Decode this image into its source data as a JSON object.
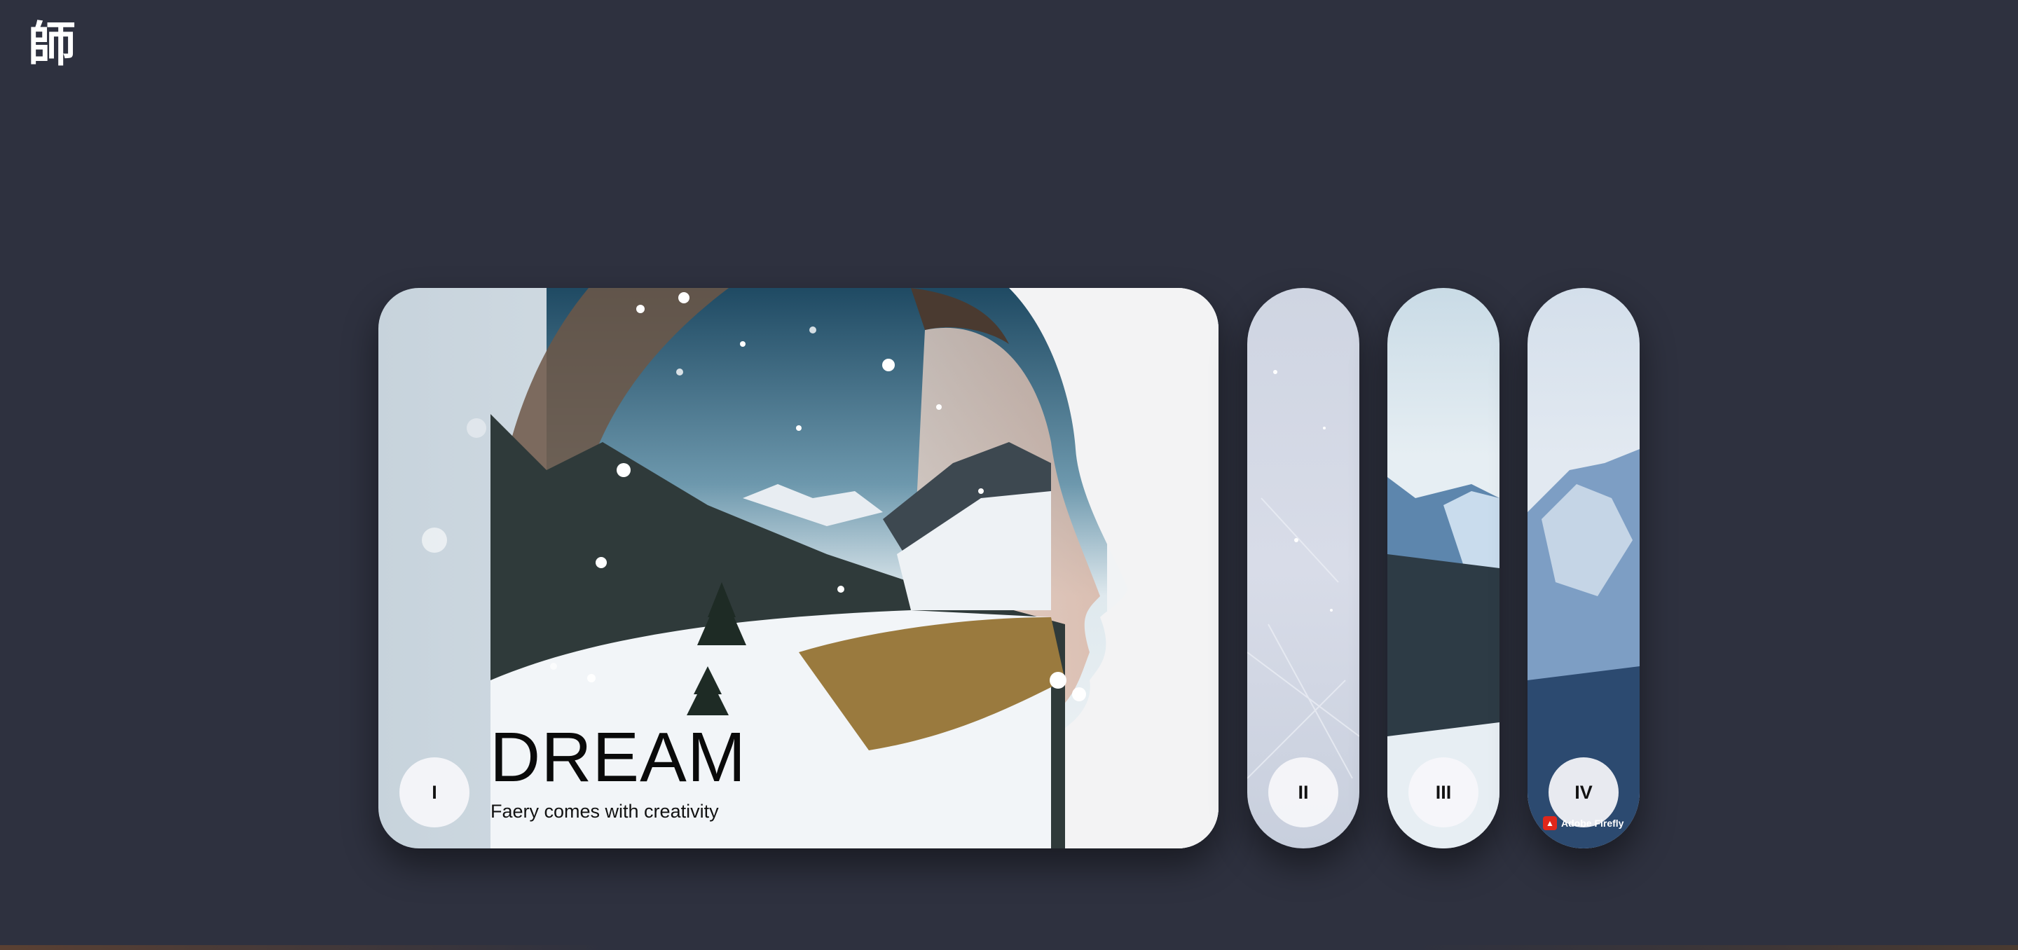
{
  "app": {
    "logo_text": "師"
  },
  "cards": [
    {
      "numeral": "I",
      "title": "DREAM",
      "subtitle": "Faery comes with creativity",
      "active": true
    },
    {
      "numeral": "II",
      "active": false
    },
    {
      "numeral": "III",
      "active": false
    },
    {
      "numeral": "IV",
      "active": false,
      "badge": "Adobe Firefly"
    }
  ],
  "colors": {
    "background": "#2e313f",
    "button_bg": "#f6f6fa",
    "badge_red": "#e0271b"
  }
}
